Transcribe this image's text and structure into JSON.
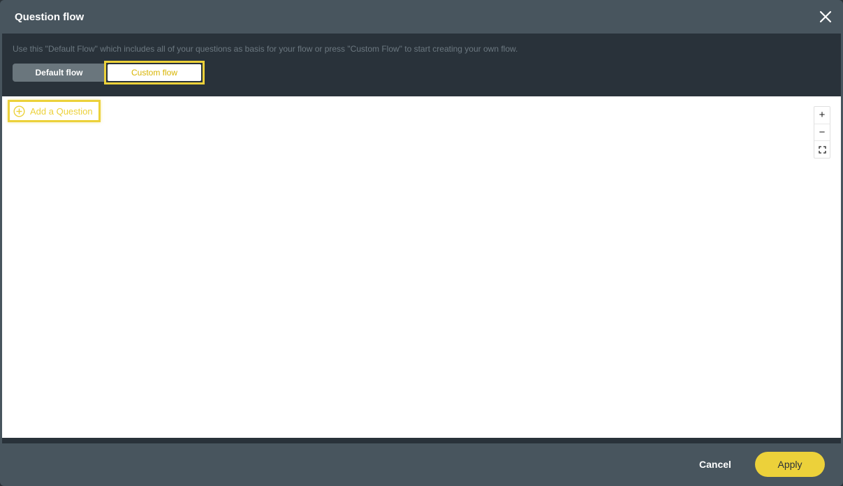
{
  "dialog": {
    "title": "Question flow",
    "close_icon": "close-icon"
  },
  "toolbar": {
    "hint": "Use this \"Default Flow\" which includes all of your questions as basis for your flow or press \"Custom Flow\" to start creating your own flow.",
    "default_flow_label": "Default flow",
    "custom_flow_label": "Custom flow",
    "selected": "Custom flow"
  },
  "canvas": {
    "add_question_label": "Add a Question",
    "zoom_in_symbol": "+",
    "zoom_out_symbol": "−",
    "fit_icon": "fit-screen-icon"
  },
  "footer": {
    "cancel_label": "Cancel",
    "apply_label": "Apply"
  },
  "colors": {
    "accent": "#ecd13a",
    "header_bg": "#48555e",
    "toolbar_bg": "#29323a"
  }
}
